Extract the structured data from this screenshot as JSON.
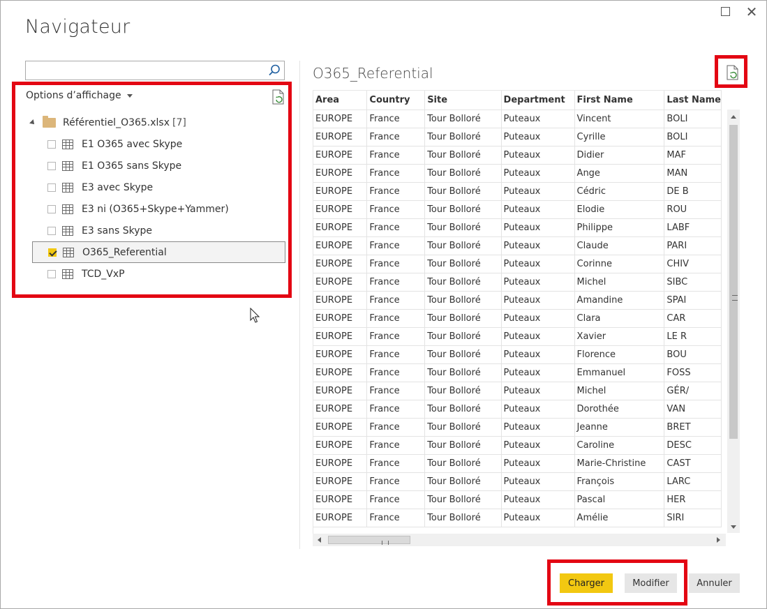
{
  "window": {
    "title": "Navigateur"
  },
  "left_pane": {
    "search": {
      "value": "",
      "placeholder": ""
    },
    "display_options": "Options d’affichage",
    "root": {
      "name": "Référentiel_O365.xlsx",
      "count": "[7]"
    },
    "items": [
      {
        "label": "E1 O365 avec Skype",
        "checked": false
      },
      {
        "label": "E1 O365 sans Skype",
        "checked": false
      },
      {
        "label": "E3 avec Skype",
        "checked": false
      },
      {
        "label": "E3 ni (O365+Skype+Yammer)",
        "checked": false
      },
      {
        "label": "E3 sans Skype",
        "checked": false
      },
      {
        "label": "O365_Referential",
        "checked": true
      },
      {
        "label": "TCD_VxP",
        "checked": false
      }
    ]
  },
  "preview": {
    "title": "O365_Referential",
    "columns": [
      "Area",
      "Country",
      "Site",
      "Department",
      "First Name",
      "Last Name"
    ],
    "rows": [
      [
        "EUROPE",
        "France",
        "Tour Bolloré",
        "Puteaux",
        "Vincent",
        "BOLI"
      ],
      [
        "EUROPE",
        "France",
        "Tour Bolloré",
        "Puteaux",
        "Cyrille",
        "BOLI"
      ],
      [
        "EUROPE",
        "France",
        "Tour Bolloré",
        "Puteaux",
        "Didier",
        "MAF"
      ],
      [
        "EUROPE",
        "France",
        "Tour Bolloré",
        "Puteaux",
        "Ange",
        "MAN"
      ],
      [
        "EUROPE",
        "France",
        "Tour Bolloré",
        "Puteaux",
        "Cédric",
        "DE B"
      ],
      [
        "EUROPE",
        "France",
        "Tour Bolloré",
        "Puteaux",
        "Elodie",
        "ROU"
      ],
      [
        "EUROPE",
        "France",
        "Tour Bolloré",
        "Puteaux",
        "Philippe",
        "LABF"
      ],
      [
        "EUROPE",
        "France",
        "Tour Bolloré",
        "Puteaux",
        "Claude",
        "PARI"
      ],
      [
        "EUROPE",
        "France",
        "Tour Bolloré",
        "Puteaux",
        "Corinne",
        "CHIV"
      ],
      [
        "EUROPE",
        "France",
        "Tour Bolloré",
        "Puteaux",
        "Michel",
        "SIBC"
      ],
      [
        "EUROPE",
        "France",
        "Tour Bolloré",
        "Puteaux",
        "Amandine",
        "SPAI"
      ],
      [
        "EUROPE",
        "France",
        "Tour Bolloré",
        "Puteaux",
        "Clara",
        "CAR"
      ],
      [
        "EUROPE",
        "France",
        "Tour Bolloré",
        "Puteaux",
        "Xavier",
        "LE R"
      ],
      [
        "EUROPE",
        "France",
        "Tour Bolloré",
        "Puteaux",
        "Florence",
        "BOU"
      ],
      [
        "EUROPE",
        "France",
        "Tour Bolloré",
        "Puteaux",
        "Emmanuel",
        "FOSS"
      ],
      [
        "EUROPE",
        "France",
        "Tour Bolloré",
        "Puteaux",
        "Michel",
        "GÉR/"
      ],
      [
        "EUROPE",
        "France",
        "Tour Bolloré",
        "Puteaux",
        "Dorothée",
        "VAN"
      ],
      [
        "EUROPE",
        "France",
        "Tour Bolloré",
        "Puteaux",
        "Jeanne",
        "BRET"
      ],
      [
        "EUROPE",
        "France",
        "Tour Bolloré",
        "Puteaux",
        "Caroline",
        "DESC"
      ],
      [
        "EUROPE",
        "France",
        "Tour Bolloré",
        "Puteaux",
        "Marie-Christine",
        "CAST"
      ],
      [
        "EUROPE",
        "France",
        "Tour Bolloré",
        "Puteaux",
        "François",
        "LARC"
      ],
      [
        "EUROPE",
        "France",
        "Tour Bolloré",
        "Puteaux",
        "Pascal",
        "HER"
      ],
      [
        "EUROPE",
        "France",
        "Tour Bolloré",
        "Puteaux",
        "Amélie",
        "SIRI"
      ]
    ]
  },
  "buttons": {
    "load": "Charger",
    "edit": "Modifier",
    "cancel": "Annuler"
  },
  "colors": {
    "accent": "#f2c811",
    "highlight": "#e30613"
  }
}
